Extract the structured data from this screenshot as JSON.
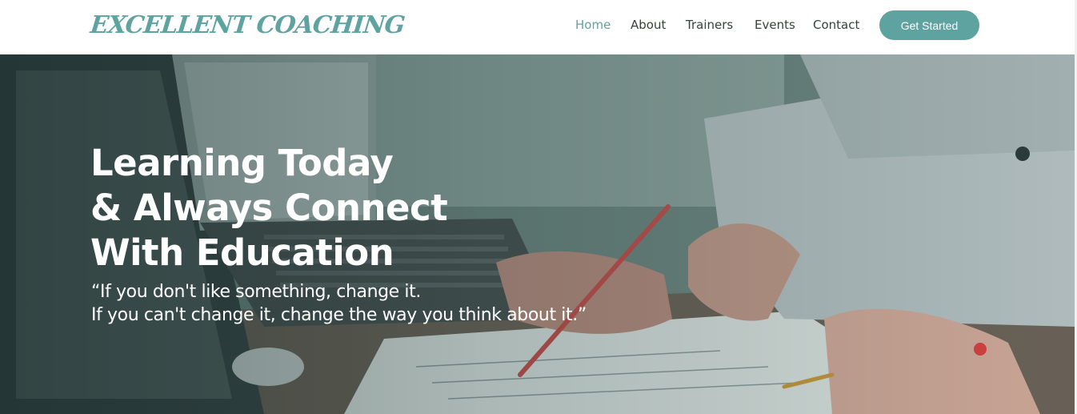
{
  "brand": {
    "logo_text": "EXCELLENT COACHING"
  },
  "nav": {
    "items": [
      {
        "label": "Home",
        "active": true
      },
      {
        "label": "About",
        "active": false
      },
      {
        "label": "Trainers",
        "active": false
      },
      {
        "label": "Events",
        "active": false
      },
      {
        "label": "Contact",
        "active": false
      }
    ],
    "cta_label": "Get Started"
  },
  "hero": {
    "title_lines": [
      "Learning Today",
      "& Always Connect",
      "With Education"
    ],
    "quote_lines": [
      "“If you don't like something, change it.",
      "If you can't change it, change the way you think about it.”"
    ]
  },
  "colors": {
    "accent": "#5fa3a0",
    "nav_text": "#37423b",
    "hero_text": "#ffffff"
  }
}
